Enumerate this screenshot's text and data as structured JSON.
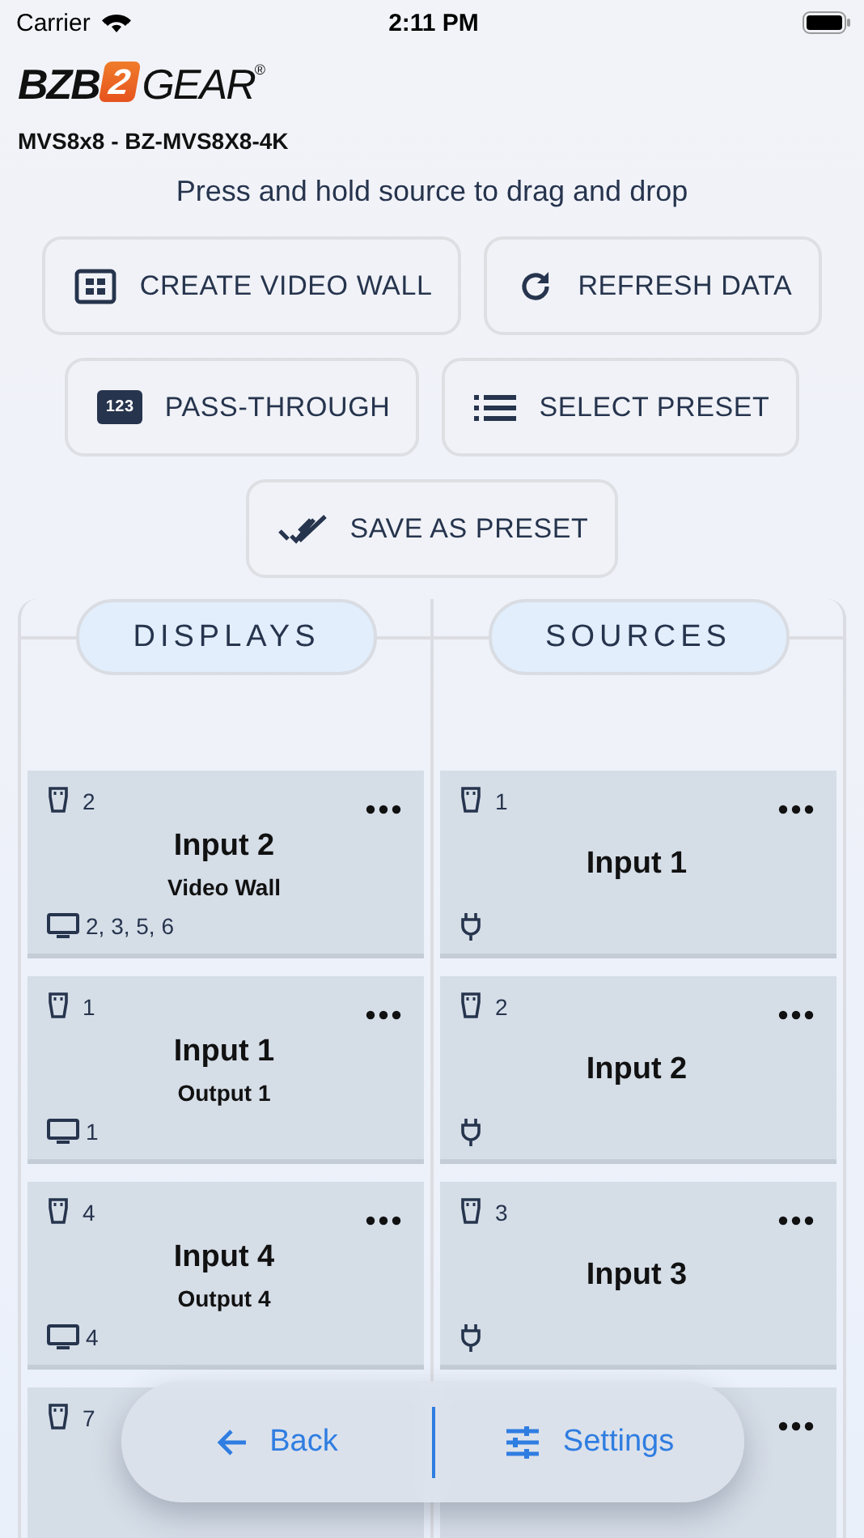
{
  "status_bar": {
    "carrier": "Carrier",
    "time": "2:11 PM"
  },
  "logo": {
    "left": "BZB",
    "mark": "2",
    "right": "GEAR",
    "reg": "®"
  },
  "model": "MVS8x8 - BZ-MVS8X8-4K",
  "hint": "Press and hold source to drag and drop",
  "button_rows": [
    [
      {
        "kind": "grid",
        "label": "CREATE VIDEO WALL"
      },
      {
        "kind": "refresh",
        "label": "REFRESH DATA"
      }
    ],
    [
      {
        "kind": "badge",
        "badge": "123",
        "label": "PASS-THROUGH"
      },
      {
        "kind": "list",
        "label": "SELECT PRESET"
      }
    ],
    [
      {
        "kind": "check",
        "label": "SAVE AS PRESET"
      }
    ]
  ],
  "columns": [
    {
      "title": "DISPLAYS",
      "kind": "displays",
      "cards": [
        {
          "port": "2",
          "name": "Input 2",
          "detail": "Video Wall",
          "foot": "2, 3, 5, 6",
          "menu": true
        },
        {
          "port": "1",
          "name": "Input 1",
          "detail": "Output 1",
          "foot": "1",
          "menu": true
        },
        {
          "port": "4",
          "name": "Input 4",
          "detail": "Output 4",
          "foot": "4",
          "menu": true
        },
        {
          "port": "7"
        }
      ]
    },
    {
      "title": "SOURCES",
      "kind": "sources",
      "cards": [
        {
          "port": "1",
          "name": "Input 1",
          "menu": true
        },
        {
          "port": "2",
          "name": "Input 2",
          "menu": true
        },
        {
          "port": "3",
          "name": "Input 3",
          "menu": true
        },
        {
          "menu": true
        }
      ]
    }
  ],
  "bottom_bar": {
    "back": "Back",
    "settings": "Settings"
  }
}
